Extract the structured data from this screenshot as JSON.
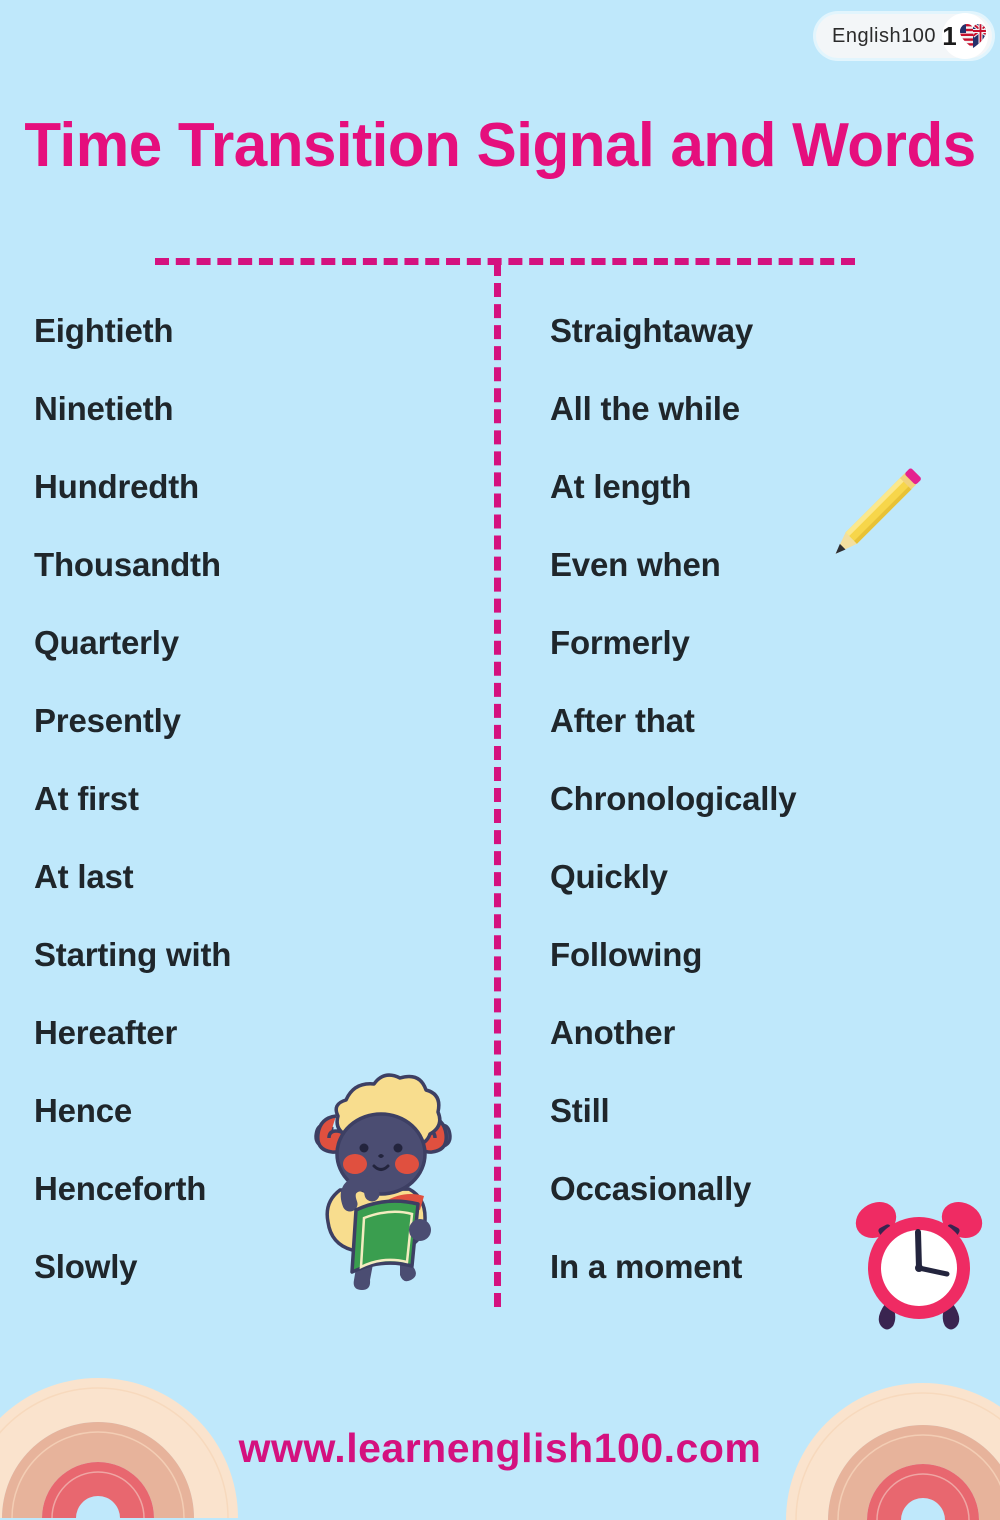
{
  "logo": {
    "text": "English100",
    "mark_digit": "1",
    "mark_icon": "flag-heart-icon"
  },
  "title": "Time Transition Signal and Words",
  "columns": {
    "left": [
      "Eightieth",
      "Ninetieth",
      "Hundredth",
      "Thousandth",
      "Quarterly",
      "Presently",
      "At first",
      "At last",
      "Starting with",
      "Hereafter",
      "Hence",
      "Henceforth",
      "Slowly"
    ],
    "right": [
      "Straightaway",
      "All the while",
      "At length",
      "Even when",
      "Formerly",
      "After that",
      "Chronologically",
      "Quickly",
      "Following",
      "Another",
      "Still",
      "Occasionally",
      "In a moment"
    ]
  },
  "decorations": {
    "pencil": "pencil-icon",
    "sheep": "sheep-reading-book-icon",
    "clock": "alarm-clock-icon",
    "rainbow_left": "rainbow-arc-icon",
    "rainbow_right": "rainbow-arc-icon"
  },
  "footer": {
    "url": "www.learnenglish100.com"
  },
  "colors": {
    "background": "#bfe8fb",
    "title_pink": "#e50f7d",
    "divider_pink": "#d4117f",
    "word_text": "#1f262b",
    "footer_pink": "#d4117f",
    "clock_body": "#ef2b63",
    "pencil_body": "#f9d84a",
    "rainbow_outer": "#fae3cd",
    "rainbow_middle": "#e7b39b",
    "rainbow_inner": "#e8676f"
  }
}
